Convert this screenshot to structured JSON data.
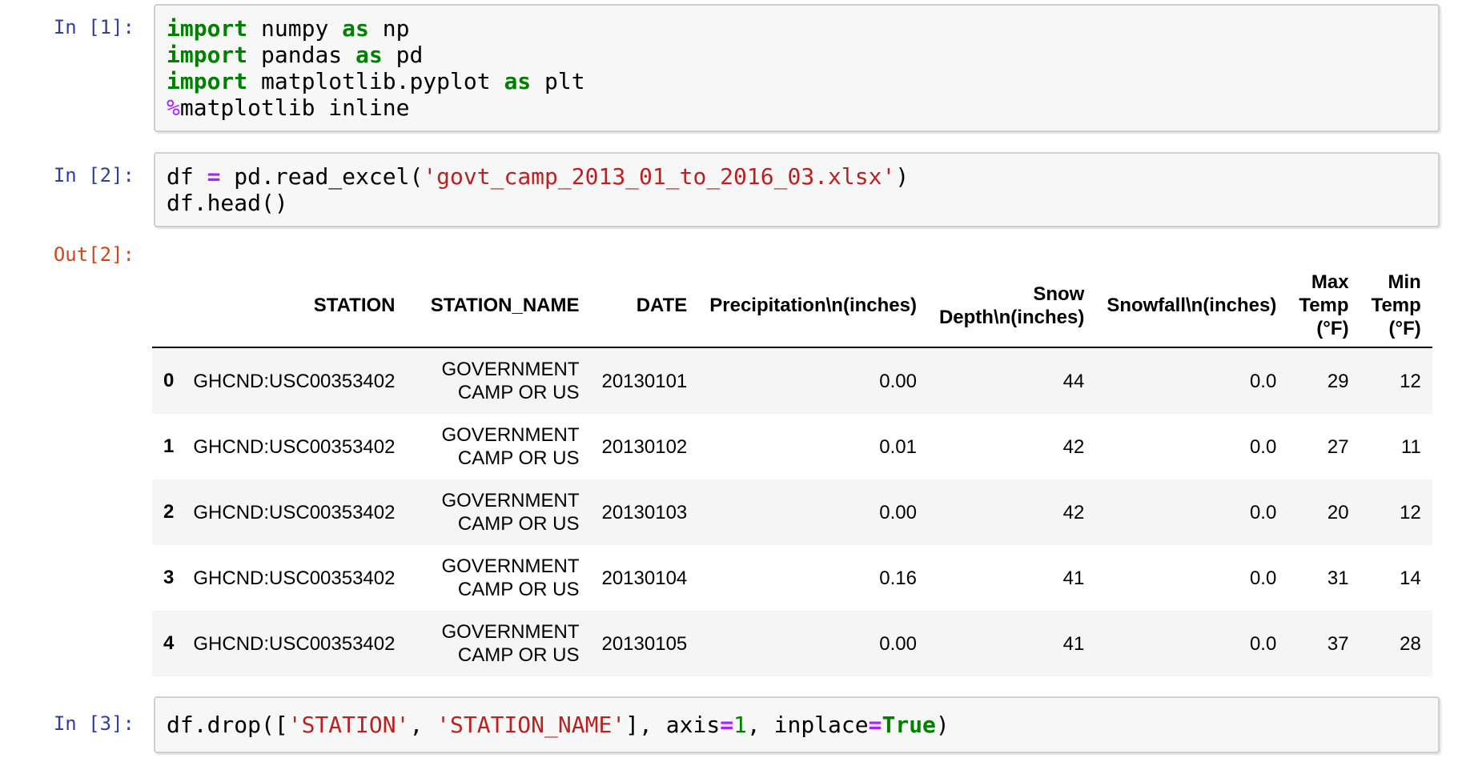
{
  "cells": [
    {
      "prompt": "In [1]:",
      "lines": [
        {
          "tokens": [
            {
              "type": "keyword",
              "text": "import"
            },
            {
              "type": "plain",
              "text": " numpy "
            },
            {
              "type": "keyword",
              "text": "as"
            },
            {
              "type": "plain",
              "text": " np"
            }
          ]
        },
        {
          "tokens": [
            {
              "type": "keyword",
              "text": "import"
            },
            {
              "type": "plain",
              "text": " pandas "
            },
            {
              "type": "keyword",
              "text": "as"
            },
            {
              "type": "plain",
              "text": " pd"
            }
          ]
        },
        {
          "tokens": [
            {
              "type": "keyword",
              "text": "import"
            },
            {
              "type": "plain",
              "text": " matplotlib.pyplot "
            },
            {
              "type": "keyword",
              "text": "as"
            },
            {
              "type": "plain",
              "text": " plt"
            }
          ]
        },
        {
          "tokens": [
            {
              "type": "magic",
              "text": "%"
            },
            {
              "type": "plain",
              "text": "matplotlib inline"
            }
          ]
        }
      ]
    },
    {
      "prompt": "In [2]:",
      "lines": [
        {
          "tokens": [
            {
              "type": "plain",
              "text": "df "
            },
            {
              "type": "operator",
              "text": "="
            },
            {
              "type": "plain",
              "text": " pd.read_excel("
            },
            {
              "type": "string",
              "text": "'govt_camp_2013_01_to_2016_03.xlsx'"
            },
            {
              "type": "plain",
              "text": ")"
            }
          ]
        },
        {
          "tokens": [
            {
              "type": "plain",
              "text": "df.head()"
            }
          ]
        }
      ]
    },
    {
      "prompt": "In [3]:",
      "lines": [
        {
          "tokens": [
            {
              "type": "plain",
              "text": "df.drop(["
            },
            {
              "type": "string",
              "text": "'STATION'"
            },
            {
              "type": "plain",
              "text": ", "
            },
            {
              "type": "string",
              "text": "'STATION_NAME'"
            },
            {
              "type": "plain",
              "text": "], axis"
            },
            {
              "type": "operator",
              "text": "="
            },
            {
              "type": "number",
              "text": "1"
            },
            {
              "type": "plain",
              "text": ", inplace"
            },
            {
              "type": "operator",
              "text": "="
            },
            {
              "type": "keyword",
              "text": "True"
            },
            {
              "type": "plain",
              "text": ")"
            }
          ]
        }
      ]
    }
  ],
  "output": {
    "prompt": "Out[2]:",
    "dataframe": {
      "headers": {
        "index": "",
        "station": "STATION",
        "station_name": "STATION_NAME",
        "date": "DATE",
        "precipitation": "Precipitation\\n(inches)",
        "snow_depth_line1": "Snow",
        "snow_depth_line2": "Depth\\n(inches)",
        "snowfall": "Snowfall\\n(inches)",
        "max_temp_line1": "Max",
        "max_temp_line2": "Temp",
        "max_temp_line3": "(°F)",
        "min_temp_line1": "Min",
        "min_temp_line2": "Temp",
        "min_temp_line3": "(°F)"
      },
      "rows": [
        {
          "index": "0",
          "station": "GHCND:USC00353402",
          "station_name": "GOVERNMENT CAMP OR US",
          "date": "20130101",
          "precipitation": "0.00",
          "snow_depth": "44",
          "snowfall": "0.0",
          "max_temp": "29",
          "min_temp": "12"
        },
        {
          "index": "1",
          "station": "GHCND:USC00353402",
          "station_name": "GOVERNMENT CAMP OR US",
          "date": "20130102",
          "precipitation": "0.01",
          "snow_depth": "42",
          "snowfall": "0.0",
          "max_temp": "27",
          "min_temp": "11"
        },
        {
          "index": "2",
          "station": "GHCND:USC00353402",
          "station_name": "GOVERNMENT CAMP OR US",
          "date": "20130103",
          "precipitation": "0.00",
          "snow_depth": "42",
          "snowfall": "0.0",
          "max_temp": "20",
          "min_temp": "12"
        },
        {
          "index": "3",
          "station": "GHCND:USC00353402",
          "station_name": "GOVERNMENT CAMP OR US",
          "date": "20130104",
          "precipitation": "0.16",
          "snow_depth": "41",
          "snowfall": "0.0",
          "max_temp": "31",
          "min_temp": "14"
        },
        {
          "index": "4",
          "station": "GHCND:USC00353402",
          "station_name": "GOVERNMENT CAMP OR US",
          "date": "20130105",
          "precipitation": "0.00",
          "snow_depth": "41",
          "snowfall": "0.0",
          "max_temp": "37",
          "min_temp": "28"
        }
      ]
    }
  },
  "colors": {
    "in_prompt": "#303F9F",
    "out_prompt": "#D84315",
    "keyword": "#008000",
    "operator": "#AA22FF",
    "string": "#BA2121",
    "number": "#008000",
    "cell_background": "#f7f7f7",
    "cell_border": "#cfcfcf",
    "row_stripe": "#f5f5f5",
    "header_rule": "#000000"
  }
}
